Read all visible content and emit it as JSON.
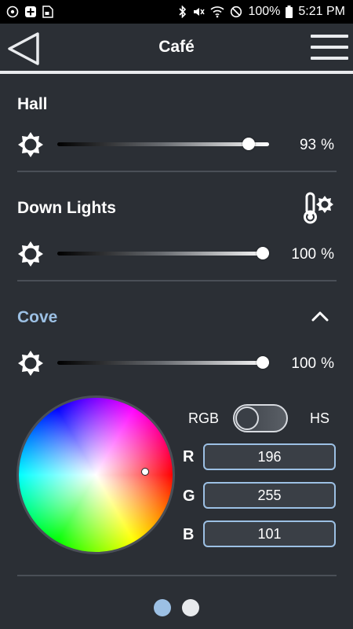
{
  "status_bar": {
    "left_icons": [
      "signal-tower-icon",
      "plus-box-icon",
      "image-file-icon"
    ],
    "right_icons": [
      "bluetooth-icon",
      "mute-icon",
      "wifi-icon",
      "dnd-icon",
      "battery-icon"
    ],
    "battery": "100%",
    "time": "5:21 PM"
  },
  "header": {
    "title": "Café",
    "back_icon": "back-triangle-icon",
    "menu_icon": "hamburger-menu-icon"
  },
  "zones": [
    {
      "name": "Hall",
      "level_percent": 93,
      "level_text": "93",
      "unit": "%"
    },
    {
      "name": "Down Lights",
      "level_percent": 100,
      "level_text": "100",
      "unit": "%",
      "extra_icon": "color-temperature-icon"
    },
    {
      "name": "Cove",
      "level_percent": 100,
      "level_text": "100",
      "unit": "%",
      "expanded": true,
      "collapse_icon": "chevron-up-icon"
    }
  ],
  "color_control": {
    "mode_left": "RGB",
    "mode_right": "HS",
    "selected_mode": "RGB",
    "channels": [
      {
        "label": "R",
        "value": "196"
      },
      {
        "label": "G",
        "value": "255"
      },
      {
        "label": "B",
        "value": "101"
      }
    ]
  },
  "pagination": {
    "pages": 2,
    "current": 1
  },
  "colors": {
    "background": "#2b2f35",
    "accent": "#9cc0e4",
    "divider": "#4a4f57",
    "status_bar": "#000000"
  }
}
